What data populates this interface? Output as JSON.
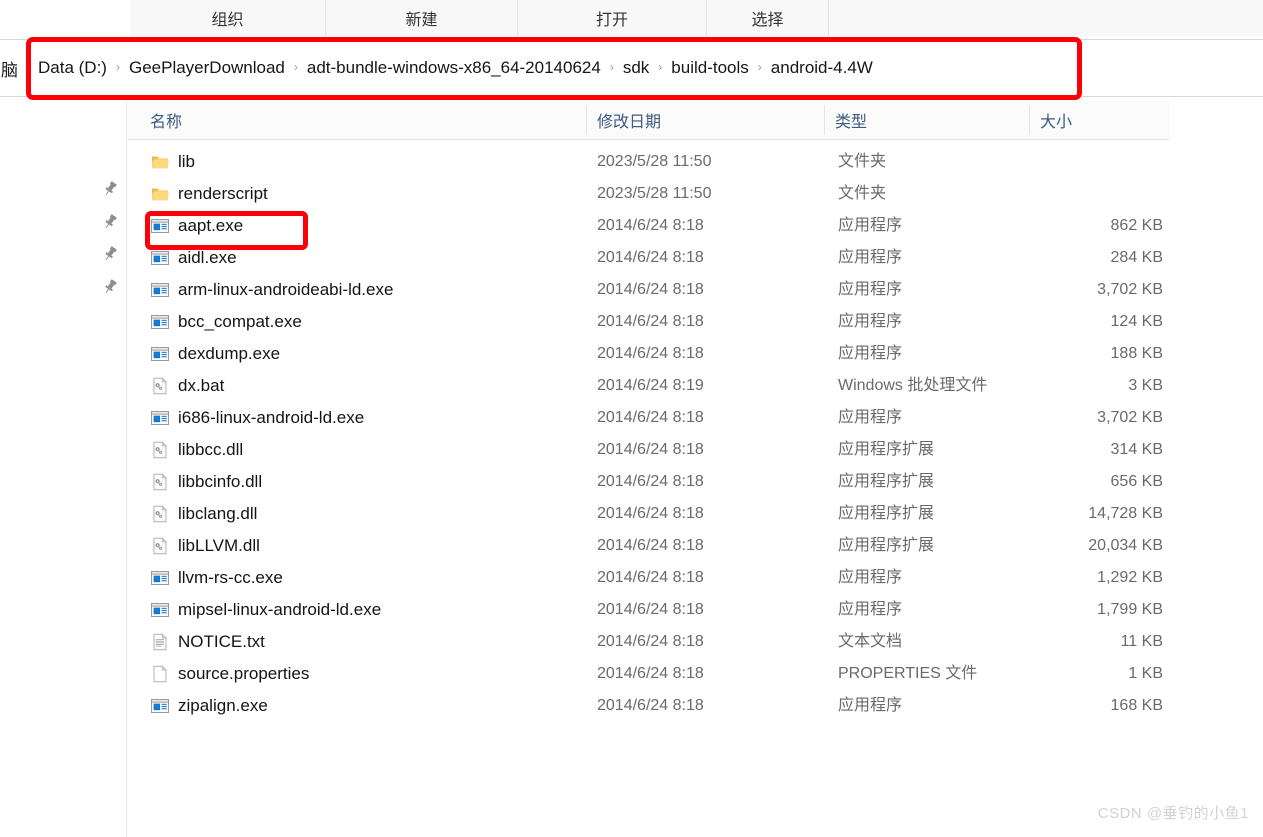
{
  "toolbar": {
    "groups": [
      {
        "label": "组织"
      },
      {
        "label": "新建"
      },
      {
        "label": "打开"
      },
      {
        "label": "选择"
      }
    ]
  },
  "breadcrumb": {
    "truncated_prefix": "脑",
    "separator": "›",
    "items": [
      {
        "label": "Data (D:)"
      },
      {
        "label": "GeePlayerDownload"
      },
      {
        "label": "adt-bundle-windows-x86_64-20140624"
      },
      {
        "label": "sdk"
      },
      {
        "label": "build-tools"
      },
      {
        "label": "android-4.4W"
      }
    ]
  },
  "columns": {
    "name": "名称",
    "date": "修改日期",
    "type": "类型",
    "size": "大小"
  },
  "sidebar": {
    "pins": [
      {
        "icon": "pin-icon"
      },
      {
        "icon": "pin-icon"
      },
      {
        "icon": "pin-icon"
      },
      {
        "icon": "pin-icon"
      }
    ]
  },
  "files": [
    {
      "icon": "folder-icon",
      "name": "lib",
      "date": "2023/5/28 11:50",
      "type": "文件夹",
      "size": ""
    },
    {
      "icon": "folder-icon",
      "name": "renderscript",
      "date": "2023/5/28 11:50",
      "type": "文件夹",
      "size": ""
    },
    {
      "icon": "exe-icon",
      "name": "aapt.exe",
      "date": "2014/6/24 8:18",
      "type": "应用程序",
      "size": "862 KB"
    },
    {
      "icon": "exe-icon",
      "name": "aidl.exe",
      "date": "2014/6/24 8:18",
      "type": "应用程序",
      "size": "284 KB"
    },
    {
      "icon": "exe-icon",
      "name": "arm-linux-androideabi-ld.exe",
      "date": "2014/6/24 8:18",
      "type": "应用程序",
      "size": "3,702 KB"
    },
    {
      "icon": "exe-icon",
      "name": "bcc_compat.exe",
      "date": "2014/6/24 8:18",
      "type": "应用程序",
      "size": "124 KB"
    },
    {
      "icon": "exe-icon",
      "name": "dexdump.exe",
      "date": "2014/6/24 8:18",
      "type": "应用程序",
      "size": "188 KB"
    },
    {
      "icon": "bat-icon",
      "name": "dx.bat",
      "date": "2014/6/24 8:19",
      "type": "Windows 批处理文件",
      "size": "3 KB"
    },
    {
      "icon": "exe-icon",
      "name": "i686-linux-android-ld.exe",
      "date": "2014/6/24 8:18",
      "type": "应用程序",
      "size": "3,702 KB"
    },
    {
      "icon": "dll-icon",
      "name": "libbcc.dll",
      "date": "2014/6/24 8:18",
      "type": "应用程序扩展",
      "size": "314 KB"
    },
    {
      "icon": "dll-icon",
      "name": "libbcinfo.dll",
      "date": "2014/6/24 8:18",
      "type": "应用程序扩展",
      "size": "656 KB"
    },
    {
      "icon": "dll-icon",
      "name": "libclang.dll",
      "date": "2014/6/24 8:18",
      "type": "应用程序扩展",
      "size": "14,728 KB"
    },
    {
      "icon": "dll-icon",
      "name": "libLLVM.dll",
      "date": "2014/6/24 8:18",
      "type": "应用程序扩展",
      "size": "20,034 KB"
    },
    {
      "icon": "exe-icon",
      "name": "llvm-rs-cc.exe",
      "date": "2014/6/24 8:18",
      "type": "应用程序",
      "size": "1,292 KB"
    },
    {
      "icon": "exe-icon",
      "name": "mipsel-linux-android-ld.exe",
      "date": "2014/6/24 8:18",
      "type": "应用程序",
      "size": "1,799 KB"
    },
    {
      "icon": "txt-icon",
      "name": "NOTICE.txt",
      "date": "2014/6/24 8:18",
      "type": "文本文档",
      "size": "11 KB"
    },
    {
      "icon": "blankfile-icon",
      "name": "source.properties",
      "date": "2014/6/24 8:18",
      "type": "PROPERTIES 文件",
      "size": "1 KB"
    },
    {
      "icon": "exe-icon",
      "name": "zipalign.exe",
      "date": "2014/6/24 8:18",
      "type": "应用程序",
      "size": "168 KB"
    }
  ],
  "annotations": {
    "color": "#fb0007",
    "breadcrumb_highlight": "breadcrumb path",
    "file_highlight": "aapt.exe"
  },
  "watermark": {
    "text": "CSDN @垂钓的小鱼1"
  }
}
